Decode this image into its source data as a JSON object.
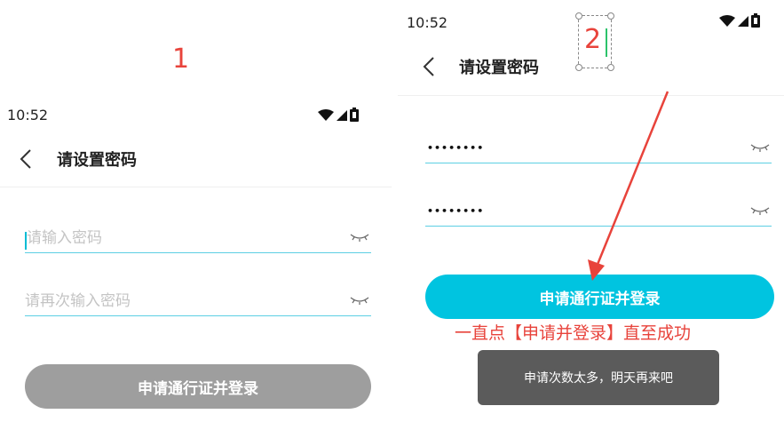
{
  "annotations": {
    "step1": "1",
    "step2": "2",
    "note": "一直点【申请并登录】直至成功"
  },
  "left": {
    "status": {
      "time": "10:52"
    },
    "header": {
      "title": "请设置密码"
    },
    "form": {
      "password_placeholder": "请输入密码",
      "confirm_placeholder": "请再次输入密码"
    },
    "submit_label": "申请通行证并登录"
  },
  "right": {
    "status": {
      "time": "10:52"
    },
    "header": {
      "title": "请设置密码"
    },
    "form": {
      "password_value": "••••••••",
      "confirm_value": "••••••••"
    },
    "submit_label": "申请通行证并登录",
    "toast": "申请次数太多，明天再来吧"
  },
  "colors": {
    "accent": "#00c4e0",
    "annotation_red": "#e8433b",
    "disabled_button": "#9e9e9e",
    "toast_bg": "#5b5b5b"
  }
}
